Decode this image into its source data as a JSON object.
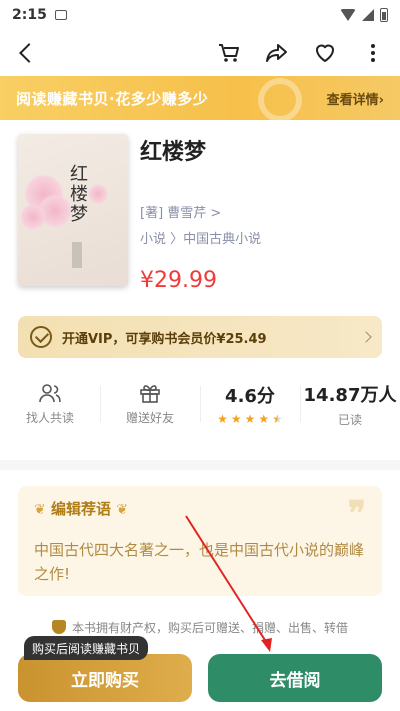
{
  "status": {
    "time": "2:15"
  },
  "banner": {
    "text": "阅读赚藏书贝·花多少赚多少",
    "detail": "查看详情›"
  },
  "book": {
    "title": "红楼梦",
    "cover_title": "红楼梦",
    "author": "[著] 曹雪芹 >",
    "category": "小说 〉中国古典小说",
    "price": "¥29.99"
  },
  "vip": {
    "text": "开通VIP，可享购书会员价¥25.49"
  },
  "stats": {
    "find": "找人共读",
    "gift": "赠送好友",
    "rating": "4.6分",
    "rating_value": 4.6,
    "readers": "14.87万人",
    "readers_label": "已读"
  },
  "editor": {
    "heading": "编辑荐语",
    "body": "中国古代四大名著之一，也是中国古代小说的巅峰之作!"
  },
  "notice": "本书拥有财产权，购买后可赠送、捐赠、出售、转借",
  "footer": {
    "tip": "购买后阅读赚藏书贝",
    "buy": "立即购买",
    "borrow": "去借阅"
  },
  "colors": {
    "accent_gold": "#f6c04a",
    "price_red": "#f23a3a",
    "borrow_green": "#2e8c66"
  }
}
